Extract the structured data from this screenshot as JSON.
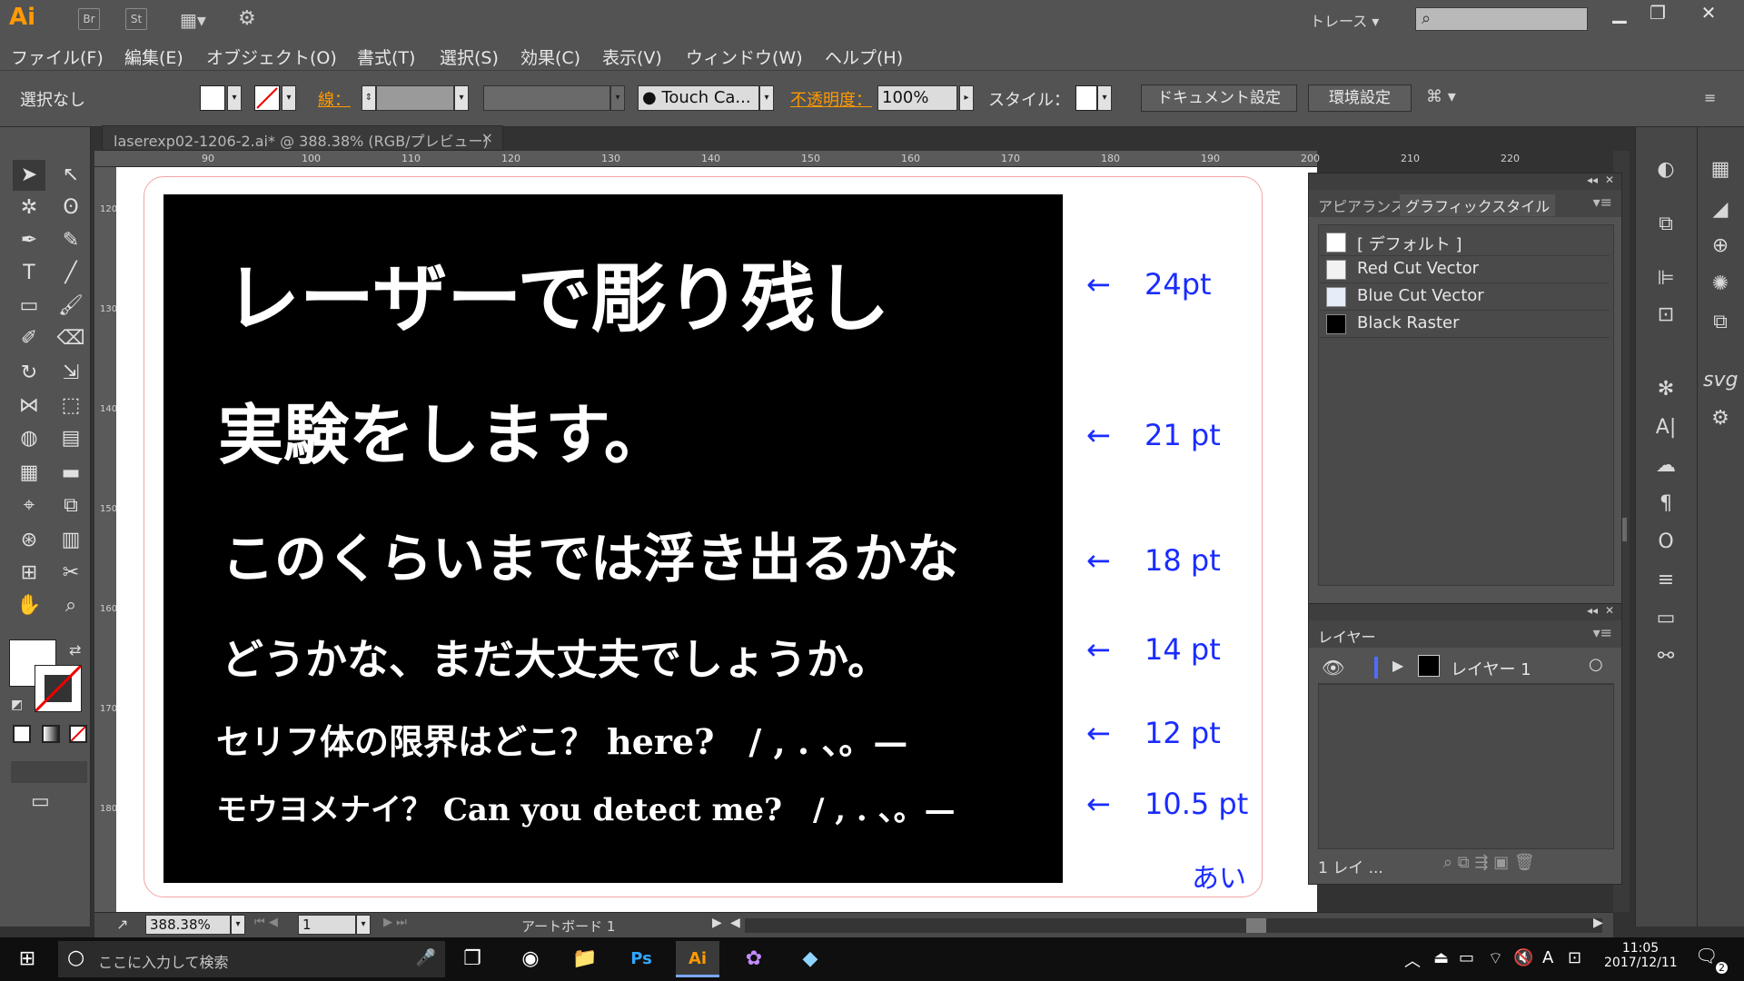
{
  "titlebar": {
    "app_logo": "Ai",
    "bridge": "Br",
    "stock": "St",
    "workspace": "トレース",
    "search_placeholder": "",
    "min": "▁",
    "restore": "❐",
    "close": "✕"
  },
  "menu": [
    "ファイル(F)",
    "編集(E)",
    "オブジェクト(O)",
    "書式(T)",
    "選択(S)",
    "効果(C)",
    "表示(V)",
    "ウィンドウ(W)",
    "ヘルプ(H)"
  ],
  "control": {
    "selection": "選択なし",
    "stroke_label": "線：",
    "brush": "Touch Ca...",
    "opacity_label": "不透明度：",
    "opacity_value": "100%",
    "style_label": "スタイル：",
    "doc_settings": "ドキュメント設定",
    "prefs": "環境設定"
  },
  "doc": {
    "tab_title": "laserexp02-1206-2.ai* @ 388.38% (RGB/プレビュー)",
    "zoom": "388.38%",
    "artboard_num": "1",
    "artboard_label": "アートボード 1"
  },
  "ruler_top": [
    "90",
    "100",
    "110",
    "120",
    "130",
    "140",
    "150",
    "160",
    "170",
    "180",
    "190",
    "200",
    "210",
    "220"
  ],
  "ruler_left": [
    "120",
    "130",
    "140",
    "150",
    "160",
    "170",
    "180"
  ],
  "artwork": {
    "lines": [
      "レーザーで彫り残し",
      "実験をします。",
      "このくらいまでは浮き出るかな",
      "どうかな、まだ大丈夫でしょうか。",
      "セリフ体の限界はどこ？ here?　/ , . 、。—",
      "モウヨメナイ？ Can you detect me?　/ , . 、。—"
    ],
    "sizes": [
      "24pt",
      "21 pt",
      "18 pt",
      "14 pt",
      "12 pt",
      "10.5 pt"
    ],
    "arrow": "←",
    "corner_text": "あい"
  },
  "graphic_styles_panel": {
    "tab_appearance": "アピアランス",
    "tab_graphic_styles": "グラフィックスタイル",
    "items": [
      {
        "label": "[ デフォルト ]",
        "color": "#ffffff"
      },
      {
        "label": "Red Cut Vector",
        "color": "#f2f2f2"
      },
      {
        "label": "Blue Cut Vector",
        "color": "#e6ecf8"
      },
      {
        "label": "Black Raster",
        "color": "#000000"
      }
    ]
  },
  "layers_panel": {
    "title": "レイヤー",
    "layer_name": "レイヤー 1",
    "footer": "1 レイ ..."
  },
  "taskbar": {
    "search_placeholder": "ここに入力して検索",
    "time": "11:05",
    "date": "2017/12/11",
    "ime": "A",
    "notif_count": "2"
  },
  "colors": {
    "accent_orange": "#ff9a00",
    "label_blue": "#1a2cff",
    "artboard_border": "#f3a4a4"
  }
}
